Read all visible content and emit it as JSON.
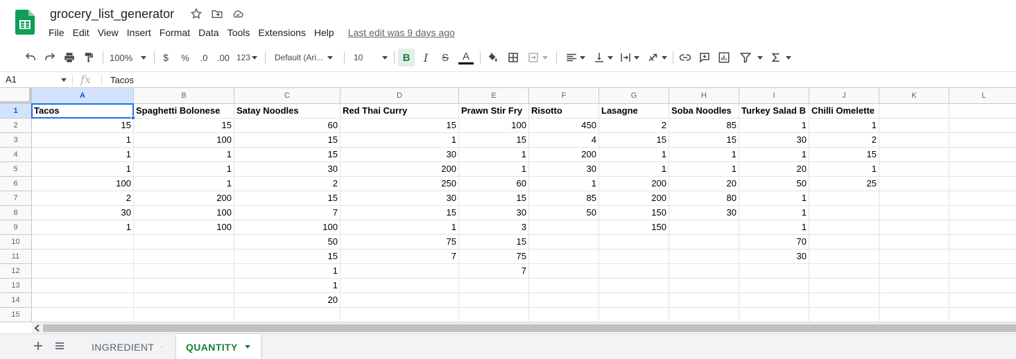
{
  "doc": {
    "title": "grocery_list_generator",
    "last_edit": "Last edit was 9 days ago"
  },
  "menu": [
    "File",
    "Edit",
    "View",
    "Insert",
    "Format",
    "Data",
    "Tools",
    "Extensions",
    "Help"
  ],
  "toolbar": {
    "zoom": "100%",
    "currency": "$",
    "percent": "%",
    "dec_decrease": ".0",
    "dec_increase": ".00",
    "more_formats": "123",
    "font": "Default (Ari...",
    "font_size": "10",
    "bold": "B",
    "italic": "I",
    "strike": "S",
    "text_color": "A"
  },
  "formula_bar": {
    "name_box": "A1",
    "fx": "fx",
    "content": "Tacos"
  },
  "grid": {
    "columns": [
      "A",
      "B",
      "C",
      "D",
      "E",
      "F",
      "G",
      "H",
      "I",
      "J",
      "K",
      "L"
    ],
    "rows": [
      "1",
      "2",
      "3",
      "4",
      "5",
      "6",
      "7",
      "8",
      "9",
      "10",
      "11",
      "12",
      "13",
      "14",
      "15"
    ],
    "headers": [
      "Tacos",
      "Spaghetti Bolonese",
      "Satay Noodles",
      "Red Thai Curry",
      "Prawn Stir Fry",
      "Risotto",
      "Lasagne",
      "Soba Noodles",
      "Turkey Salad B",
      "Chilli Omelette",
      "",
      ""
    ],
    "data": [
      [
        "15",
        "15",
        "60",
        "15",
        "100",
        "450",
        "2",
        "85",
        "1",
        "1",
        "",
        ""
      ],
      [
        "1",
        "100",
        "15",
        "1",
        "15",
        "4",
        "15",
        "15",
        "30",
        "2",
        "",
        ""
      ],
      [
        "1",
        "1",
        "15",
        "30",
        "1",
        "200",
        "1",
        "1",
        "1",
        "15",
        "",
        ""
      ],
      [
        "1",
        "1",
        "30",
        "200",
        "1",
        "30",
        "1",
        "1",
        "20",
        "1",
        "",
        ""
      ],
      [
        "100",
        "1",
        "2",
        "250",
        "60",
        "1",
        "200",
        "20",
        "50",
        "25",
        "",
        ""
      ],
      [
        "2",
        "200",
        "15",
        "30",
        "15",
        "85",
        "200",
        "80",
        "1",
        "",
        "",
        ""
      ],
      [
        "30",
        "100",
        "7",
        "15",
        "30",
        "50",
        "150",
        "30",
        "1",
        "",
        "",
        ""
      ],
      [
        "1",
        "100",
        "100",
        "1",
        "3",
        "",
        "150",
        "",
        "1",
        "",
        "",
        ""
      ],
      [
        "",
        "",
        "50",
        "75",
        "15",
        "",
        "",
        "",
        "70",
        "",
        "",
        ""
      ],
      [
        "",
        "",
        "15",
        "7",
        "75",
        "",
        "",
        "",
        "30",
        "",
        "",
        ""
      ],
      [
        "",
        "",
        "1",
        "",
        "7",
        "",
        "",
        "",
        "",
        "",
        "",
        ""
      ],
      [
        "",
        "",
        "1",
        "",
        "",
        "",
        "",
        "",
        "",
        "",
        "",
        ""
      ],
      [
        "",
        "",
        "20",
        "",
        "",
        "",
        "",
        "",
        "",
        "",
        "",
        ""
      ],
      [
        "",
        "",
        "",
        "",
        "",
        "",
        "",
        "",
        "",
        "",
        "",
        ""
      ]
    ]
  },
  "sheets": [
    {
      "name": "INGREDIENT",
      "active": false
    },
    {
      "name": "QUANTITY",
      "active": true
    }
  ],
  "colors": {
    "accent_green": "#188038",
    "selection_blue": "#1a73e8",
    "header_bg": "#f8f9fa"
  }
}
